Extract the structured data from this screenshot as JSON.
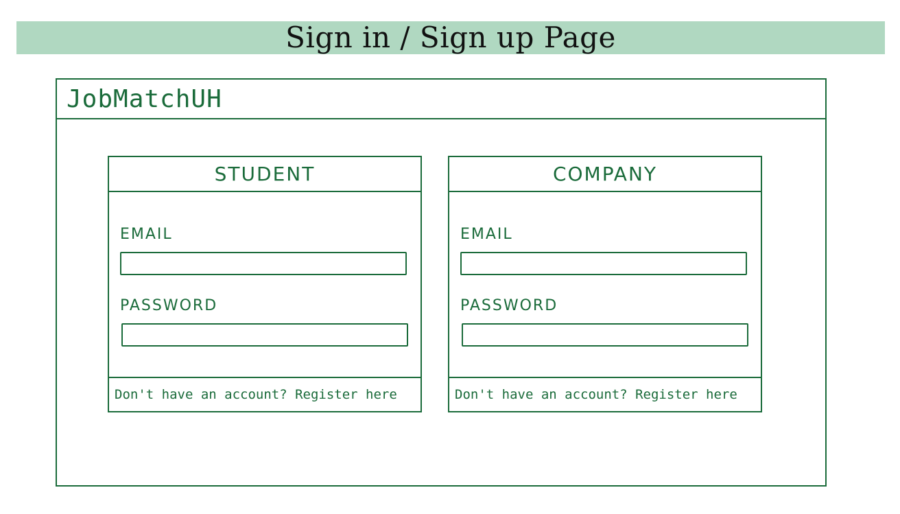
{
  "page_title": "Sign in / Sign up Page",
  "app": {
    "logo": "JobMatchUH"
  },
  "cards": {
    "student": {
      "title": "STUDENT",
      "email_label": "EMAIL",
      "password_label": "PASSWORD",
      "email_value": "",
      "password_value": "",
      "register_text": "Don't have an account? Register here"
    },
    "company": {
      "title": "COMPANY",
      "email_label": "EMAIL",
      "password_label": "PASSWORD",
      "email_value": "",
      "password_value": "",
      "register_text": "Don't have an account? Register here"
    }
  },
  "colors": {
    "accent": "#1a6b3a",
    "banner": "#b0d8c1"
  }
}
